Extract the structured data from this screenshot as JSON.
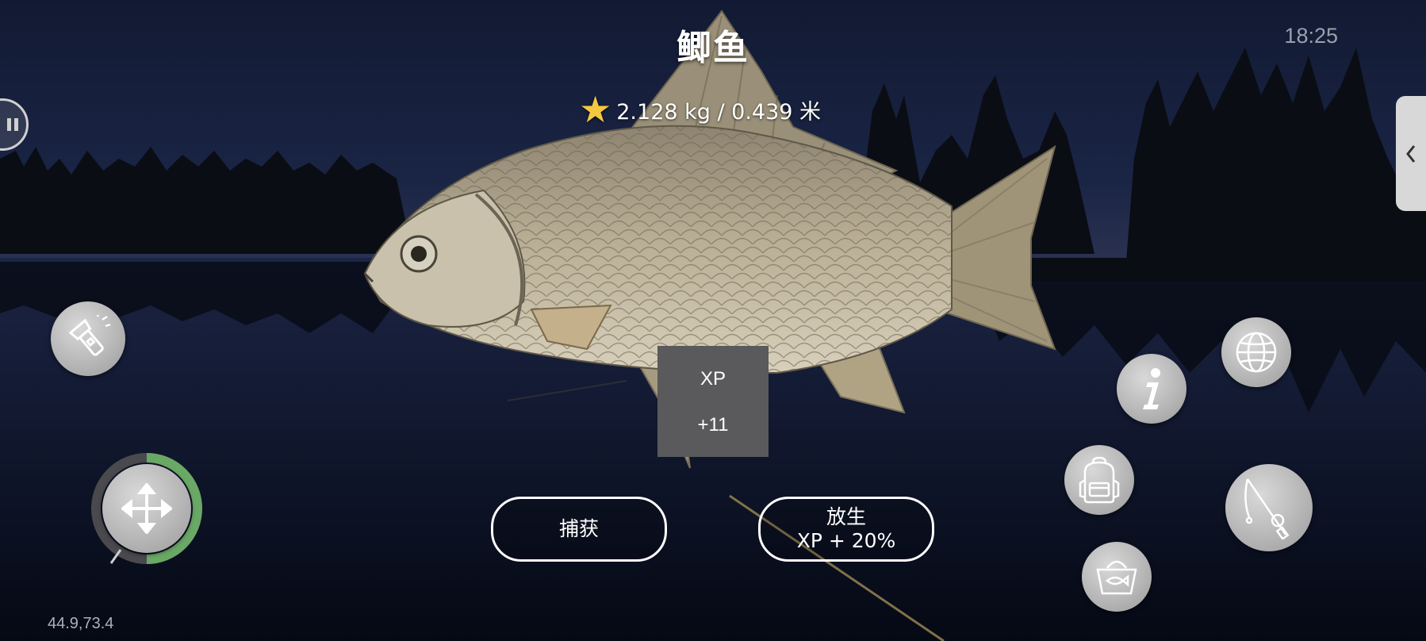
{
  "fish": {
    "name": "鲫鱼",
    "measurement": "2.128 kg / 0.439 米"
  },
  "clock": "18:25",
  "coordinates": "44.9,73.4",
  "xp_popup": {
    "label": "XP",
    "value": "+11"
  },
  "actions": {
    "keep_label": "捕获",
    "release_line1": "放生",
    "release_line2": "XP + 20%"
  },
  "controls": {
    "flashlight": "flashlight-icon",
    "joystick": "move-arrows-icon",
    "joystick_ring_fill_fraction": 0.5,
    "info": "info-icon",
    "globe": "globe-icon",
    "backpack": "backpack-icon",
    "keepnet": "fish-basket-icon",
    "rod": "fishing-rod-icon",
    "side_tab": "chevron-left-icon",
    "pause": "pause-icon"
  },
  "colors": {
    "star": "#f5c842",
    "joystick_ring": "#6aa866",
    "xp_box": "#5a5a5c"
  }
}
